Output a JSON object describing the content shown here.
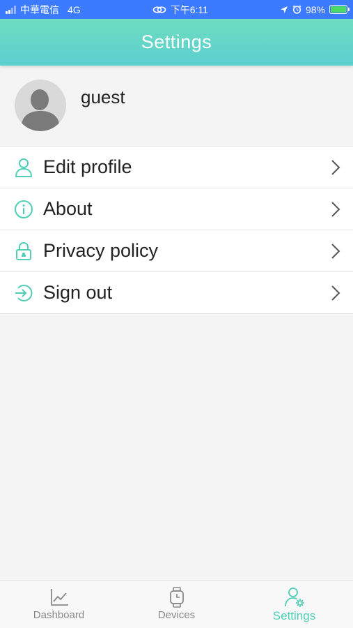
{
  "status_bar": {
    "carrier": "中華電信",
    "network": "4G",
    "time": "下午6:11",
    "battery_pct": "98%"
  },
  "header": {
    "title": "Settings"
  },
  "profile": {
    "name": "guest"
  },
  "menu": {
    "items": [
      {
        "label": "Edit profile",
        "icon": "user-icon"
      },
      {
        "label": "About",
        "icon": "info-icon"
      },
      {
        "label": "Privacy policy",
        "icon": "lock-icon"
      },
      {
        "label": "Sign out",
        "icon": "sign-out-icon"
      }
    ]
  },
  "tabbar": {
    "tabs": [
      {
        "label": "Dashboard",
        "icon": "chart-icon",
        "active": false
      },
      {
        "label": "Devices",
        "icon": "watch-icon",
        "active": false
      },
      {
        "label": "Settings",
        "icon": "user-settings-icon",
        "active": true
      }
    ]
  },
  "colors": {
    "accent": "#4fcfb6",
    "header_top": "#6fdcc0",
    "header_bottom": "#5ccfd0",
    "status_bar": "#3c7bff",
    "background": "#f4f4f4"
  }
}
